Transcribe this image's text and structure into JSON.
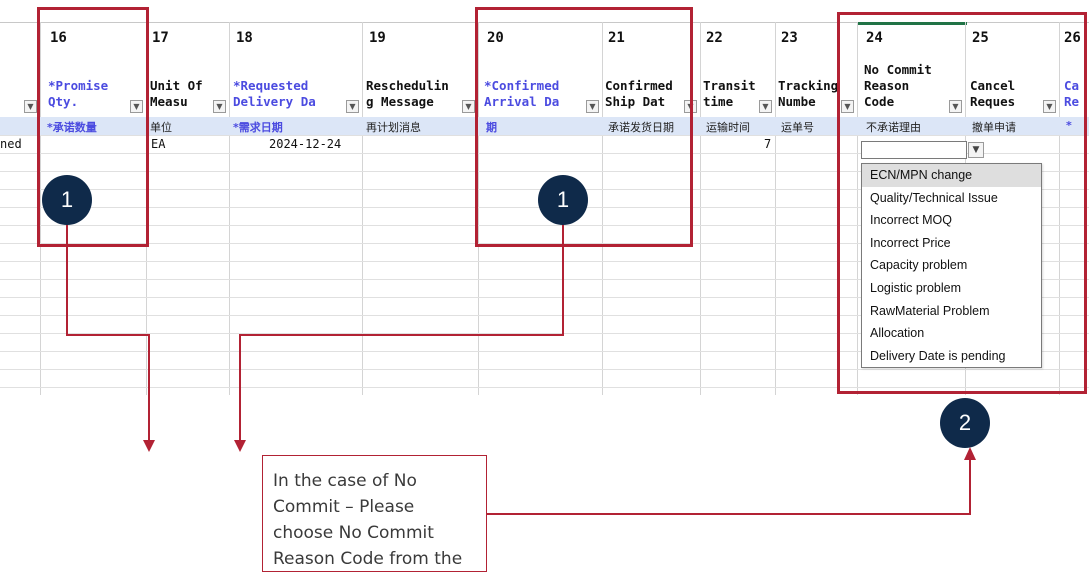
{
  "columns": [
    {
      "num": "16",
      "header": "*Promise\nQty.",
      "cn": "*承诺数量",
      "blue": true
    },
    {
      "num": "17",
      "header": "Unit Of\nMeasu",
      "cn": "单位",
      "blue": false
    },
    {
      "num": "18",
      "header": "*Requested\nDelivery Da",
      "cn": "*需求日期",
      "blue": true
    },
    {
      "num": "19",
      "header": "Reschedulin\ng Message",
      "cn": "再计划消息",
      "blue": false
    },
    {
      "num": "20",
      "header": "*Confirmed\nArrival Da",
      "cn": "期",
      "blue": true
    },
    {
      "num": "21",
      "header": "Confirmed\nShip Dat",
      "cn": "承诺发货日期",
      "blue": false
    },
    {
      "num": "22",
      "header": "Transit\ntime",
      "cn": "运输时间",
      "blue": false
    },
    {
      "num": "23",
      "header": "Tracking\nNumbe",
      "cn": "运单号",
      "blue": false
    },
    {
      "num": "24",
      "header": "No Commit\nReason\nCode",
      "cn": "不承诺理由",
      "blue": false
    },
    {
      "num": "25",
      "header": "Cancel\nReques",
      "cn": "撤单申请",
      "blue": false
    },
    {
      "num": "26",
      "header": "Ca\nRe",
      "cn": "*",
      "blue": true
    }
  ],
  "row_values": {
    "left_partial": "ned",
    "unit": "EA",
    "requested_date": "2024-12-24",
    "transit_time": "7"
  },
  "dropdown": {
    "selected": "ECN/MPN change",
    "options": [
      "ECN/MPN change",
      "Quality/Technical Issue",
      "Incorrect MOQ",
      "Incorrect Price",
      "Capacity problem",
      "Logistic problem",
      "RawMaterial Problem",
      "Allocation",
      "Delivery Date is pending"
    ]
  },
  "badges": {
    "one": "1",
    "two": "2"
  },
  "callout": {
    "text": "In the case of No Commit – Please choose No Commit Reason Code from the drop-down!"
  },
  "colors": {
    "highlight_box": "#b22234",
    "badge_fill": "#0f2a4a",
    "header_blue": "#4b4be0",
    "chinese_row": "#dce6f7"
  },
  "icons": {
    "filter_dropdown": "dropdown-arrow-icon"
  }
}
